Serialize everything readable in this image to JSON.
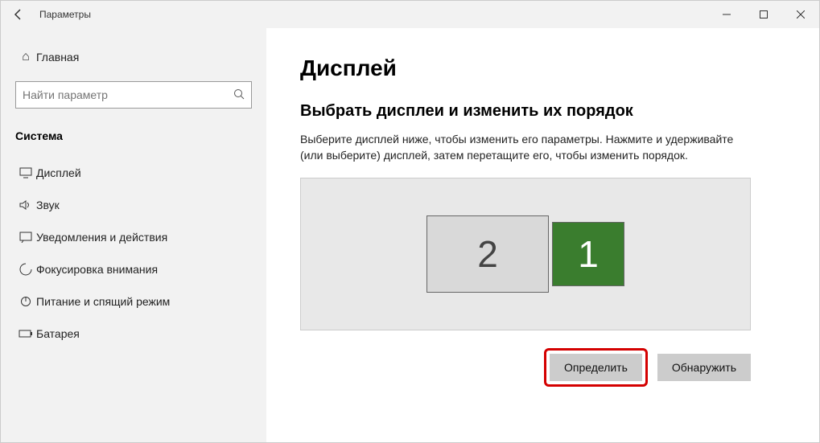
{
  "window": {
    "title": "Параметры"
  },
  "sidebar": {
    "home": "Главная",
    "search_placeholder": "Найти параметр",
    "category": "Система",
    "items": [
      {
        "label": "Дисплей"
      },
      {
        "label": "Звук"
      },
      {
        "label": "Уведомления и действия"
      },
      {
        "label": "Фокусировка внимания"
      },
      {
        "label": "Питание и спящий режим"
      },
      {
        "label": "Батарея"
      }
    ]
  },
  "main": {
    "heading": "Дисплей",
    "subheading": "Выбрать дисплеи и изменить их порядок",
    "description": "Выберите дисплей ниже, чтобы изменить его параметры. Нажмите и удерживайте (или выберите) дисплей, затем перетащите его, чтобы изменить порядок.",
    "monitor1": "1",
    "monitor2": "2",
    "identify_button": "Определить",
    "detect_button": "Обнаружить"
  }
}
